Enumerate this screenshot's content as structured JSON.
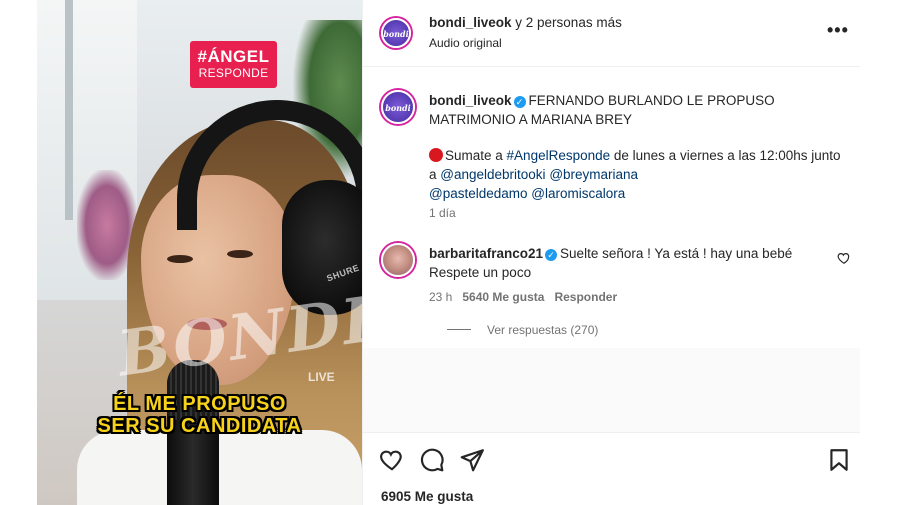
{
  "media": {
    "badge_line1": "#ÁNGEL",
    "badge_line2": "RESPONDE",
    "watermark": "BONDI",
    "watermark_sub": "LIVE",
    "headphone_brand": "SHURE",
    "caption_line1": "ÉL ME PROPUSO",
    "caption_line2": "SER SU CANDIDATA"
  },
  "header": {
    "username": "bondi_liveok",
    "collab_suffix": " y 2 personas más",
    "subtitle": "Audio original",
    "more": "•••"
  },
  "caption_post": {
    "username": "bondi_liveok",
    "title": "FERNANDO BURLANDO LE PROPUSO",
    "title2": "MATRIMONIO A MARIANA BREY",
    "body_pre": "Sumate a ",
    "hashtag": "#AngelResponde",
    "body_post": " de lunes a viernes a las 12:00hs junto",
    "line2_pre": "a ",
    "mention1": "@angeldebritooki",
    "mention2": "@breymariana",
    "mention3": "@pasteldedamo",
    "mention4": "@laromiscalora",
    "time": "1 día"
  },
  "comment": {
    "username": "barbaritafranco21",
    "text1": "Suelte señora ! Ya está ! hay una bebé",
    "text2": "Respete un poco",
    "time": "23 h",
    "likes": "5640 Me gusta",
    "reply": "Responder",
    "view_replies": "Ver respuestas (270)"
  },
  "footer": {
    "likes": "6905 Me gusta"
  },
  "colors": {
    "badge": "#e8204f",
    "caption_yellow": "#f7d21a",
    "link": "#00376b",
    "verified": "#1d9bf0",
    "text": "#262626",
    "secondary": "#737373"
  }
}
